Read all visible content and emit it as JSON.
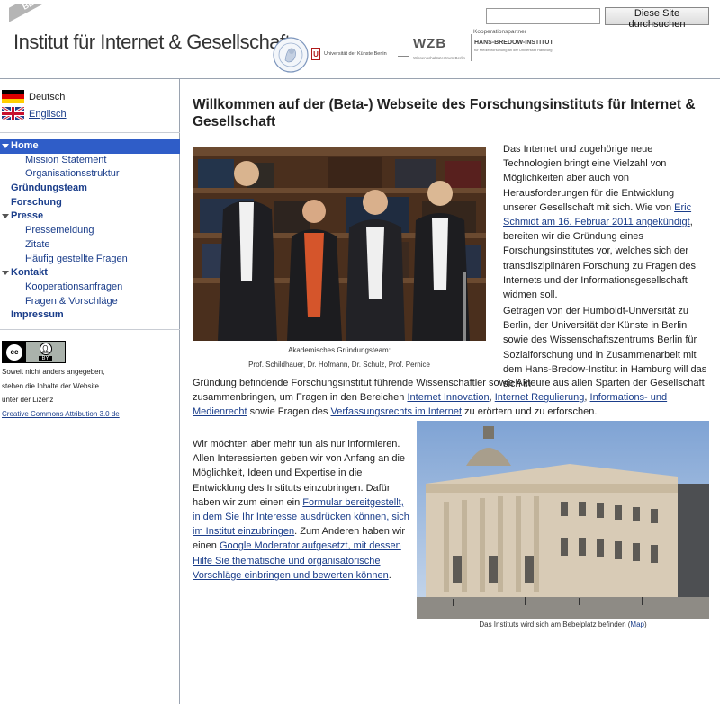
{
  "header": {
    "beta_badge": "BETA",
    "site_title": "Institut für Internet & Gesellschaft",
    "search": {
      "placeholder": "",
      "button_label": "Diese Site durchsuchen"
    },
    "partner_label": "Kooperationspartner",
    "logos": {
      "udk": "Universität der Künste Berlin",
      "wzb": "WZB",
      "wzb_sub": "Wissenschaftszentrum Berlin",
      "hbi": "HANS-BREDOW-INSTITUT",
      "hbi_sub": "für Medienforschung an der Universität Hamburg"
    }
  },
  "sidebar": {
    "languages": [
      {
        "label": "Deutsch"
      },
      {
        "label": "Englisch"
      }
    ],
    "nav": [
      {
        "label": "Home",
        "level": 1,
        "active": true,
        "expandable": true
      },
      {
        "label": "Mission Statement",
        "level": 2
      },
      {
        "label": "Organisationsstruktur",
        "level": 2
      },
      {
        "label": "Gründungsteam",
        "level": 1
      },
      {
        "label": "Forschung",
        "level": 1
      },
      {
        "label": "Presse",
        "level": 1,
        "expandable": true
      },
      {
        "label": "Pressemeldung",
        "level": 2
      },
      {
        "label": "Zitate",
        "level": 2
      },
      {
        "label": "Häufig gestellte Fragen",
        "level": 2
      },
      {
        "label": "Kontakt",
        "level": 1,
        "expandable": true
      },
      {
        "label": "Kooperationsanfragen",
        "level": 2
      },
      {
        "label": "Fragen & Vorschläge",
        "level": 2
      },
      {
        "label": "Impressum",
        "level": 1
      }
    ],
    "license": {
      "badge_cc": "cc",
      "badge_by": "BY",
      "line1": "Soweit nicht anders angegeben,",
      "line2": "stehen die Inhalte der Website",
      "line3": "unter der Lizenz",
      "link": "Creative Commons Attribution 3.0 de"
    }
  },
  "main": {
    "heading": "Willkommen auf der (Beta-) Webseite des Forschungsinstituts für Internet & Gesellschaft",
    "p1_a": "Das Internet und zugehörige neue Technologien bringt eine Vielzahl von Möglichkeiten aber auch von Herausforderungen für die Entwicklung unserer Gesellschaft mit sich. Wie von ",
    "p1_link": "Eric Schmidt am 16. Februar 2011 angekündigt",
    "p1_b": ", bereiten wir die Gründung eines Forschungsinstitutes vor, welches sich der transdisziplinären Forschung zu Fragen des Internets und der Informationsgesellschaft widmen soll.",
    "p2": "Getragen von der Humboldt-Universität zu Berlin, der Universität der Künste in Berlin sowie des Wissenschaftszentrums Berlin für Sozialforschung und in Zusammenarbeit mit dem Hans-Bredow-Institut in Hamburg will das sich in",
    "p2b_a": "Gründung befindende Forschungsinstitut führende Wissenschaftler sowie Akteure aus allen Sparten der Gesellschaft zusammenbringen, um Fragen in den Bereichen ",
    "p2b_link1": "Internet Innovation",
    "p2b_sep1": ", ",
    "p2b_link2": "Internet Regulierung",
    "p2b_sep2": ", ",
    "p2b_link3": "Informations- und Medienrecht",
    "p2b_b": " sowie Fragen des ",
    "p2b_link4": "Verfassungsrechts im Internet",
    "p2b_c": " zu erörtern und zu erforschen.",
    "p3_a": "Wir möchten aber mehr tun als nur informieren. Allen Interessierten geben wir von Anfang an die Möglichkeit, Ideen und Expertise in die Entwicklung des Instituts einzubringen. Dafür haben wir zum einen ein ",
    "p3_link1": "Formular bereitgestellt, in dem Sie Ihr Interesse ausdrücken können, sich im Institut einzubringen",
    "p3_b": ". Zum Anderen haben wir einen ",
    "p3_link2": "Google Moderator aufgesetzt, mit dessen Hilfe Sie thematische und organisatorische Vorschläge einbringen und bewerten können",
    "p3_c": ".",
    "team_caption_1": "Akademisches Gründungsteam:",
    "team_caption_2": "Prof. Schildhauer, Dr. Hofmann, Dr. Schulz, Prof. Pernice",
    "building_caption_a": "Das Instituts wird sich am Bebelplatz befinden (",
    "building_caption_link": "Map",
    "building_caption_b": ")"
  }
}
